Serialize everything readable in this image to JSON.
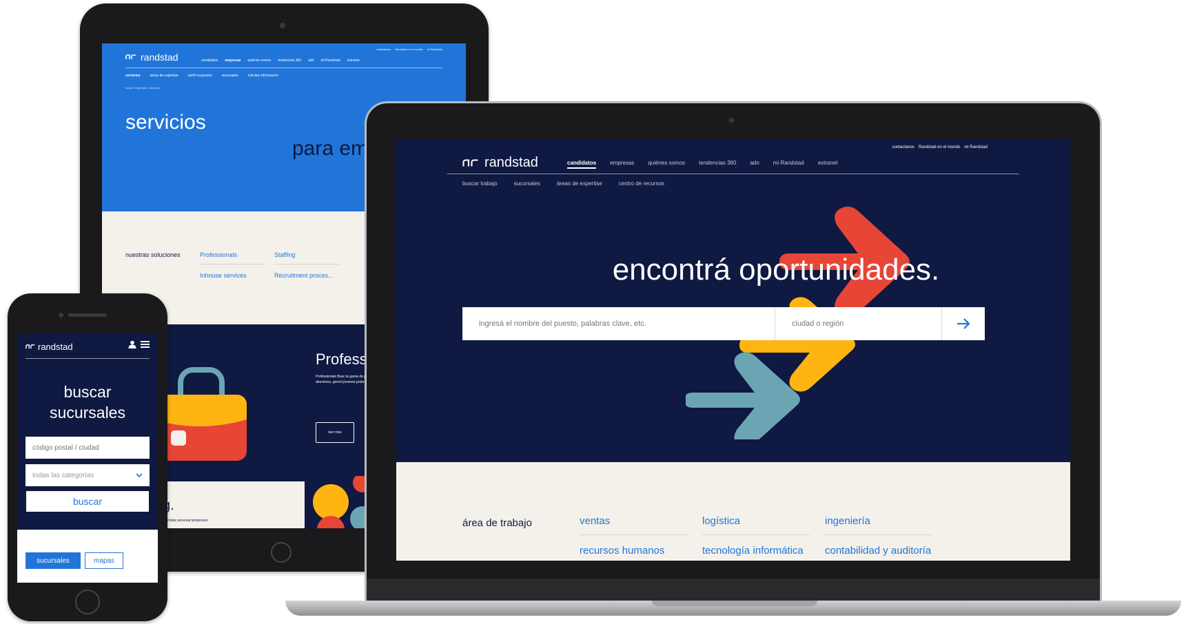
{
  "brand": {
    "name": "randstad",
    "navy": "#0f1941",
    "blue": "#2175d9",
    "cream": "#f4f1eb",
    "red": "#e74536",
    "yellow": "#ffb511",
    "teal": "#6ba5b4"
  },
  "tablet": {
    "util": [
      "contactanos",
      "Randstad en el mundo",
      "mi Randstad"
    ],
    "nav": [
      "candidatos",
      "empresas",
      "quiénes somos",
      "tendencias 360",
      "adn",
      "mi Randstad",
      "extranet"
    ],
    "subnav": [
      "servicios",
      "áreas de expertise",
      "perfil ocupación",
      "sucursales",
      "solicitar información"
    ],
    "breadcrumb": "home / empresas / servicios",
    "title": "servicios",
    "title2": "para em",
    "solutions_label": "nuestras soluciones",
    "solutions": [
      "Professionals",
      "Staffing",
      "Inhouse services",
      "Recruitment proces..."
    ],
    "promo_title": "Profess",
    "promo_text": "Professionals Busc la gama de posicio directores, gerent jóvenes profesiona",
    "promo_button": "leer más",
    "footer_title": "g.",
    "footer_sub": "a brindar personal temporario"
  },
  "laptop": {
    "util": [
      "contactanos",
      "Randstad en el mundo",
      "mi Randstad"
    ],
    "nav": [
      "candidatos",
      "empresas",
      "quiénes somos",
      "tendencias 360",
      "adn",
      "mi Randstad",
      "extranet"
    ],
    "subnav": [
      "buscar trabajo",
      "sucursales",
      "áreas de expertise",
      "centro de recursos"
    ],
    "hero": "encontrá oportunidades.",
    "search": {
      "keyword_placeholder": "ingresá el nombre del puesto, palabras clave, etc.",
      "city_placeholder": "ciudad o región"
    },
    "area_label": "área de trabajo",
    "categories": [
      "ventas",
      "logística",
      "ingeniería",
      "recursos humanos",
      "tecnología informática",
      "contabilidad y auditoría"
    ]
  },
  "phone": {
    "title_line1": "buscar",
    "title_line2": "sucursales",
    "postal_placeholder": "código postal / ciudad",
    "category_select": "todas las categorías",
    "search_button": "buscar",
    "tabs": [
      "sucursales",
      "mapas"
    ]
  }
}
